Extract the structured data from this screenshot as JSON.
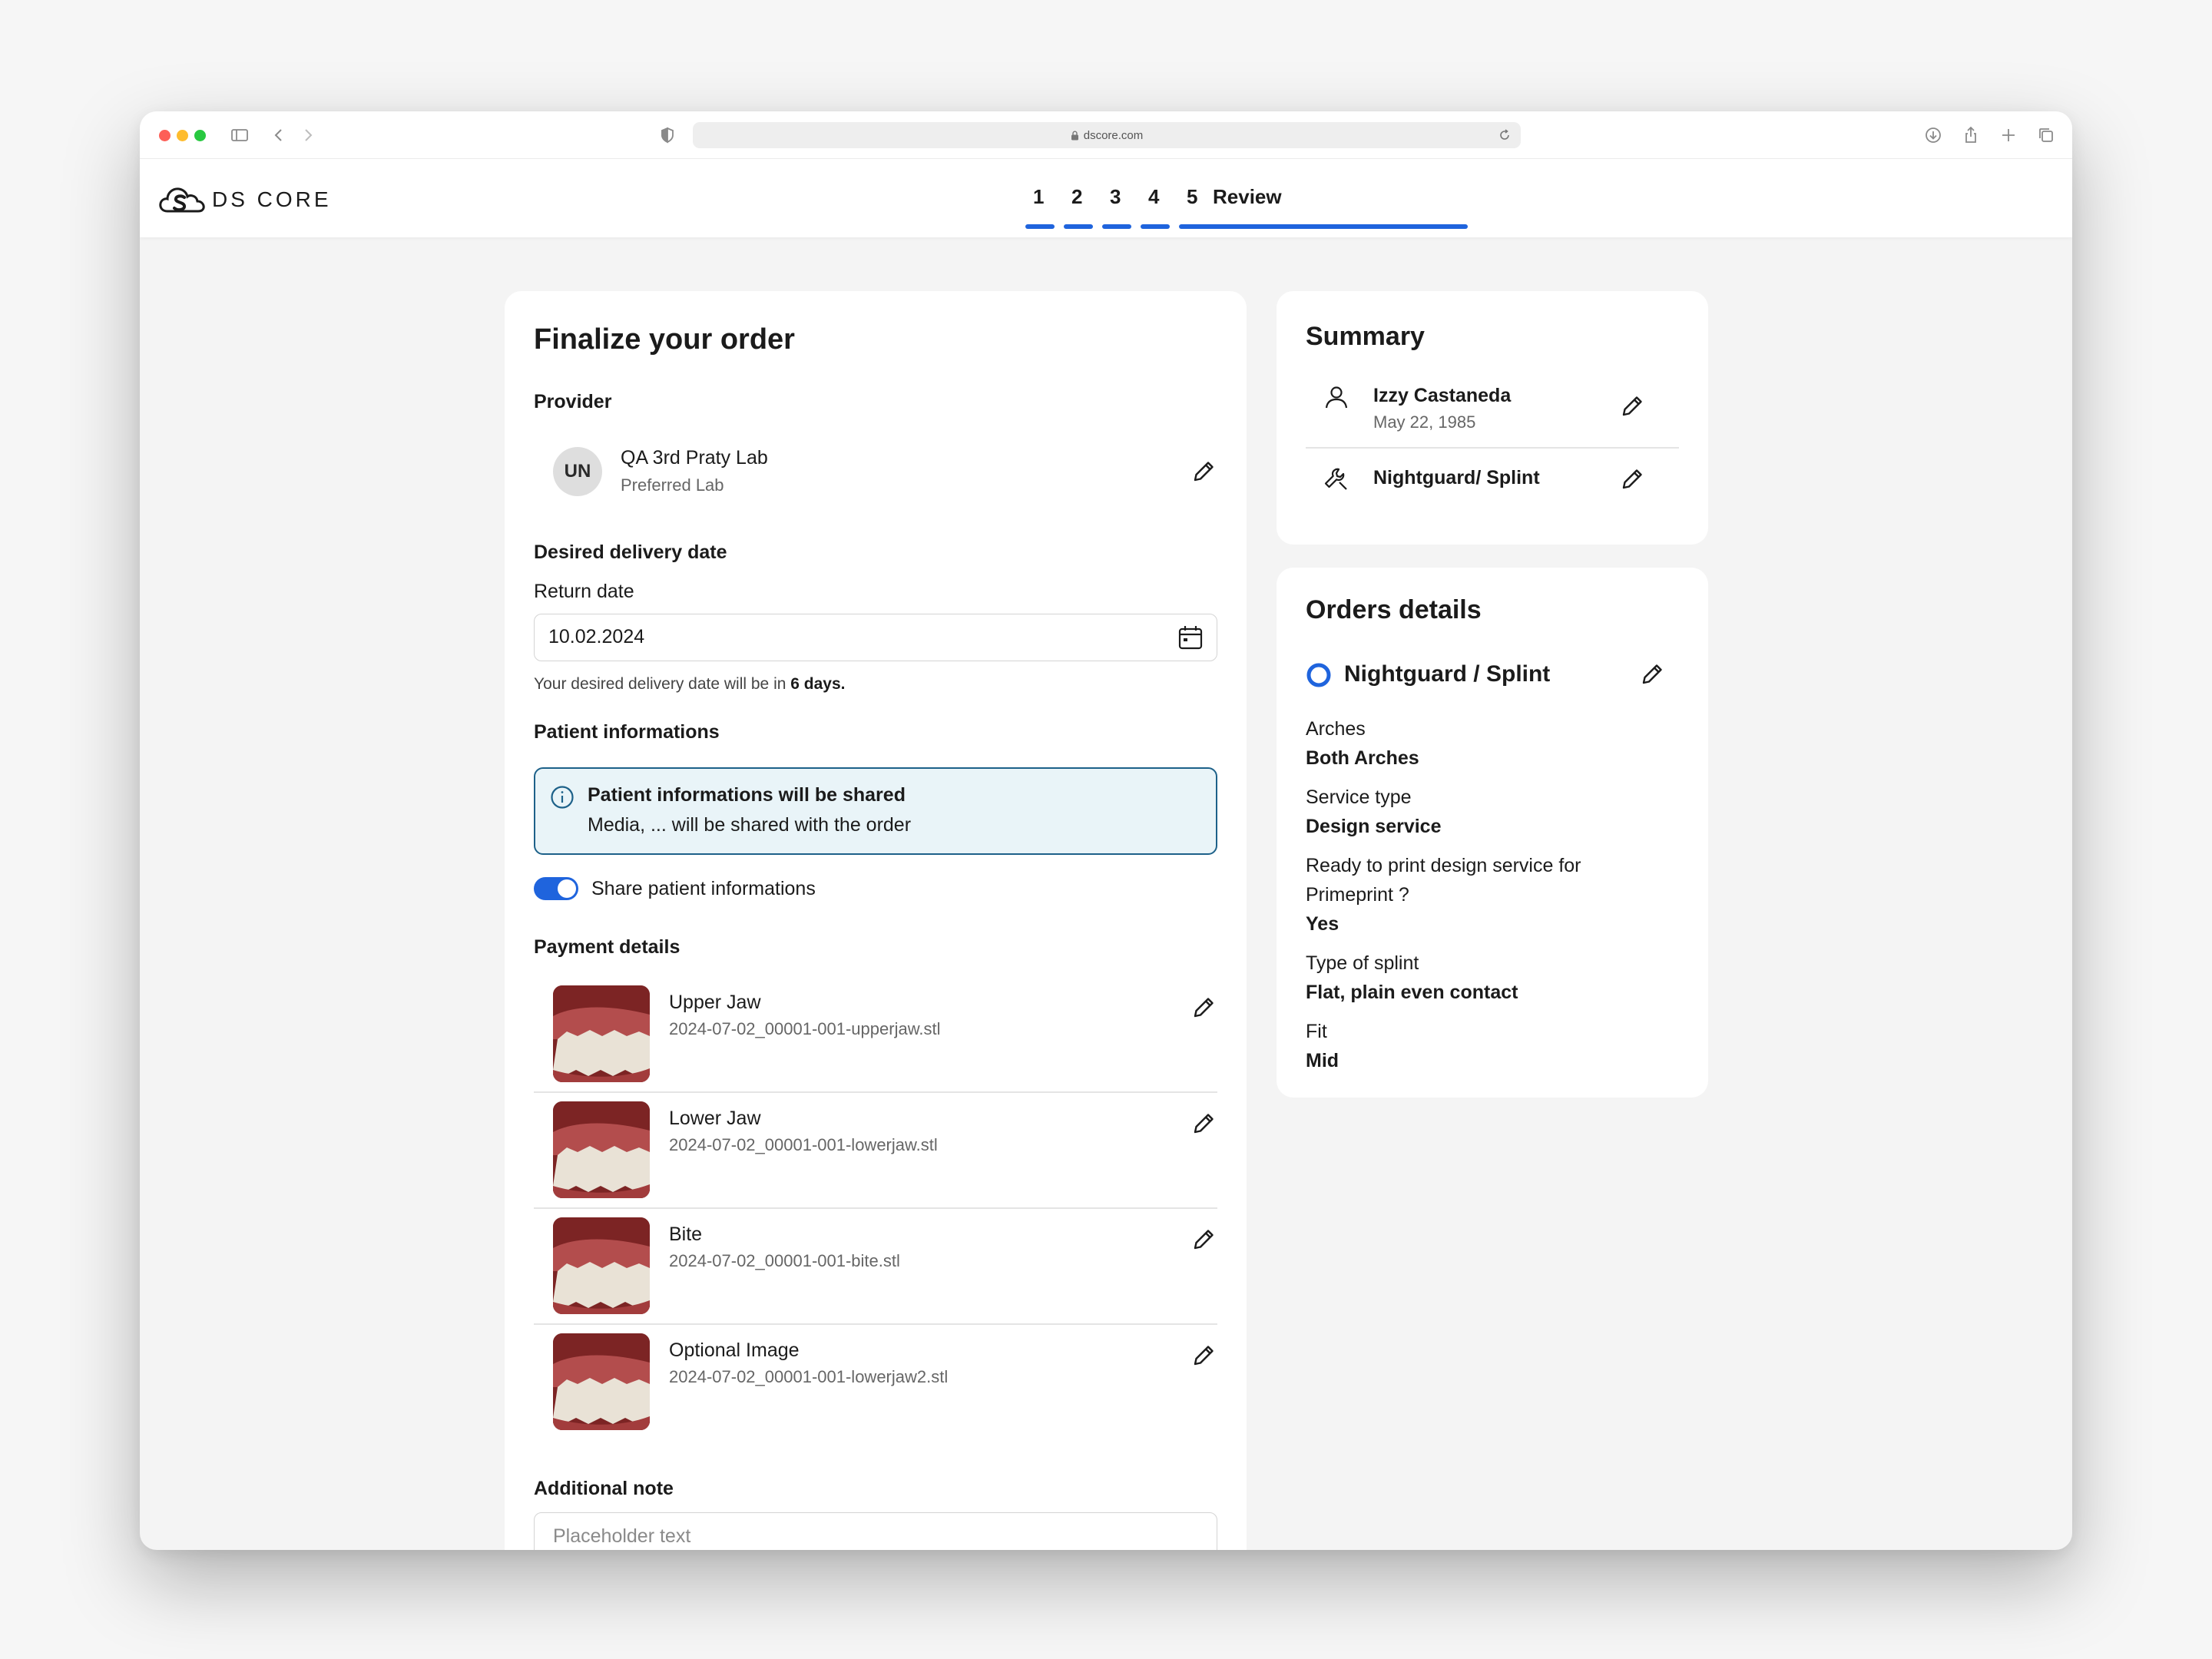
{
  "browser": {
    "url": "dscore.com"
  },
  "app": {
    "logo_text": "DS CORE",
    "steps": [
      "1",
      "2",
      "3",
      "4",
      "5"
    ],
    "current_step_label": "Review"
  },
  "main": {
    "title": "Finalize your order",
    "provider": {
      "section_label": "Provider",
      "avatar_initials": "UN",
      "name": "QA 3rd Praty Lab",
      "subtitle": "Preferred Lab"
    },
    "delivery": {
      "section_label": "Desired delivery date",
      "field_label": "Return date",
      "value": "10.02.2024",
      "helper_prefix": "Your desired delivery date will be in",
      "helper_bold": "6 days."
    },
    "patient": {
      "section_label": "Patient informations",
      "info_title": "Patient informations will be shared",
      "info_text": "Media, ... will be shared with the order",
      "toggle_label": "Share patient informations",
      "toggle_on": true
    },
    "payment": {
      "section_label": "Payment details",
      "items": [
        {
          "name": "Upper Jaw",
          "file": "2024-07-02_00001-001-upperjaw.stl"
        },
        {
          "name": "Lower Jaw",
          "file": "2024-07-02_00001-001-lowerjaw.stl"
        },
        {
          "name": "Bite",
          "file": "2024-07-02_00001-001-bite.stl"
        },
        {
          "name": "Optional Image",
          "file": "2024-07-02_00001-001-lowerjaw2.stl"
        }
      ]
    },
    "note": {
      "section_label": "Additional note",
      "placeholder": "Placeholder text"
    }
  },
  "summary": {
    "title": "Summary",
    "patient_name": "Izzy Castaneda",
    "patient_dob": "May 22, 1985",
    "product": "Nightguard/ Splint"
  },
  "orders": {
    "title": "Orders details",
    "product": "Nightguard / Splint",
    "fields": [
      {
        "label": "Arches",
        "value": "Both Arches"
      },
      {
        "label": "Service type",
        "value": "Design service"
      },
      {
        "label_line1": "Ready to print design service for",
        "label_line2": "Primeprint ?",
        "value": "Yes"
      },
      {
        "label": "Type of splint",
        "value": "Flat, plain even contact"
      },
      {
        "label": "Fit",
        "value": "Mid"
      }
    ]
  },
  "colors": {
    "accent": "#1f64dd",
    "info_border": "#1d6189",
    "info_bg": "#e9f4f8"
  },
  "icons": [
    "sidebar-icon",
    "back-icon",
    "forward-icon",
    "shield-icon",
    "lock-icon",
    "reload-icon",
    "download-icon",
    "share-icon",
    "plus-icon",
    "tabs-icon",
    "cloud-logo-icon",
    "pencil-icon",
    "calendar-icon",
    "info-icon",
    "user-icon",
    "wrench-icon",
    "radio-ring-icon"
  ]
}
